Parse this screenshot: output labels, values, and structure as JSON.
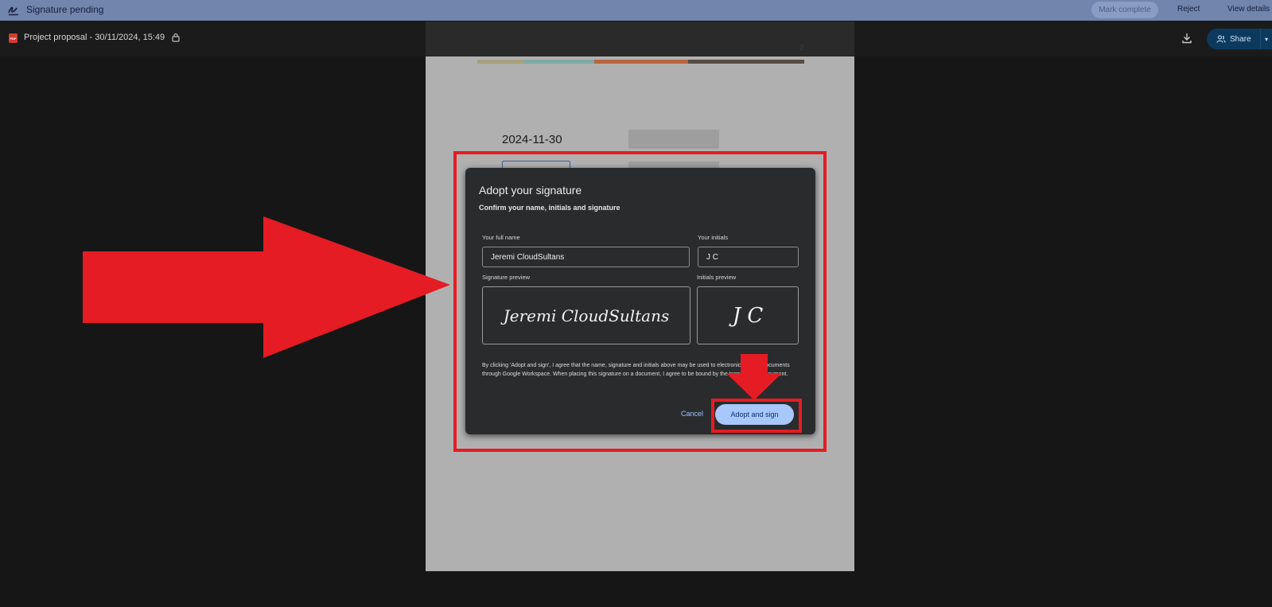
{
  "topbar": {
    "title": "Signature pending",
    "mark_complete": "Mark complete",
    "reject": "Reject",
    "view_details": "View details"
  },
  "docbar": {
    "pdf_badge": "PDF",
    "title": "Project proposal - 30/11/2024, 15:49",
    "share": "Share"
  },
  "page": {
    "number": "2",
    "date": "2024-11-30",
    "strip_colors": [
      "#a79f7c",
      "#7fa9a5",
      "#b8653f",
      "#574c45"
    ]
  },
  "dialog": {
    "title": "Adopt your signature",
    "subtitle": "Confirm your name, initials and signature",
    "full_name_label": "Your full name",
    "full_name_value": "Jeremi CloudSultans",
    "initials_label": "Your initials",
    "initials_value": "J C",
    "signature_preview_label": "Signature preview",
    "signature_preview": "Jeremi CloudSultans",
    "initials_preview_label": "Initials preview",
    "initials_preview": "J C",
    "legal": "By clicking 'Adopt and sign', I agree that the name, signature and initials above may be used to electronically sign documents through Google Workspace. When placing this signature on a document, I agree to be bound by the terms of that document.",
    "cancel": "Cancel",
    "adopt": "Adopt and sign"
  },
  "colors": {
    "annotation_red": "#e51c23",
    "primary_button": "#a8c7fa",
    "topbar": "#7185ad"
  }
}
